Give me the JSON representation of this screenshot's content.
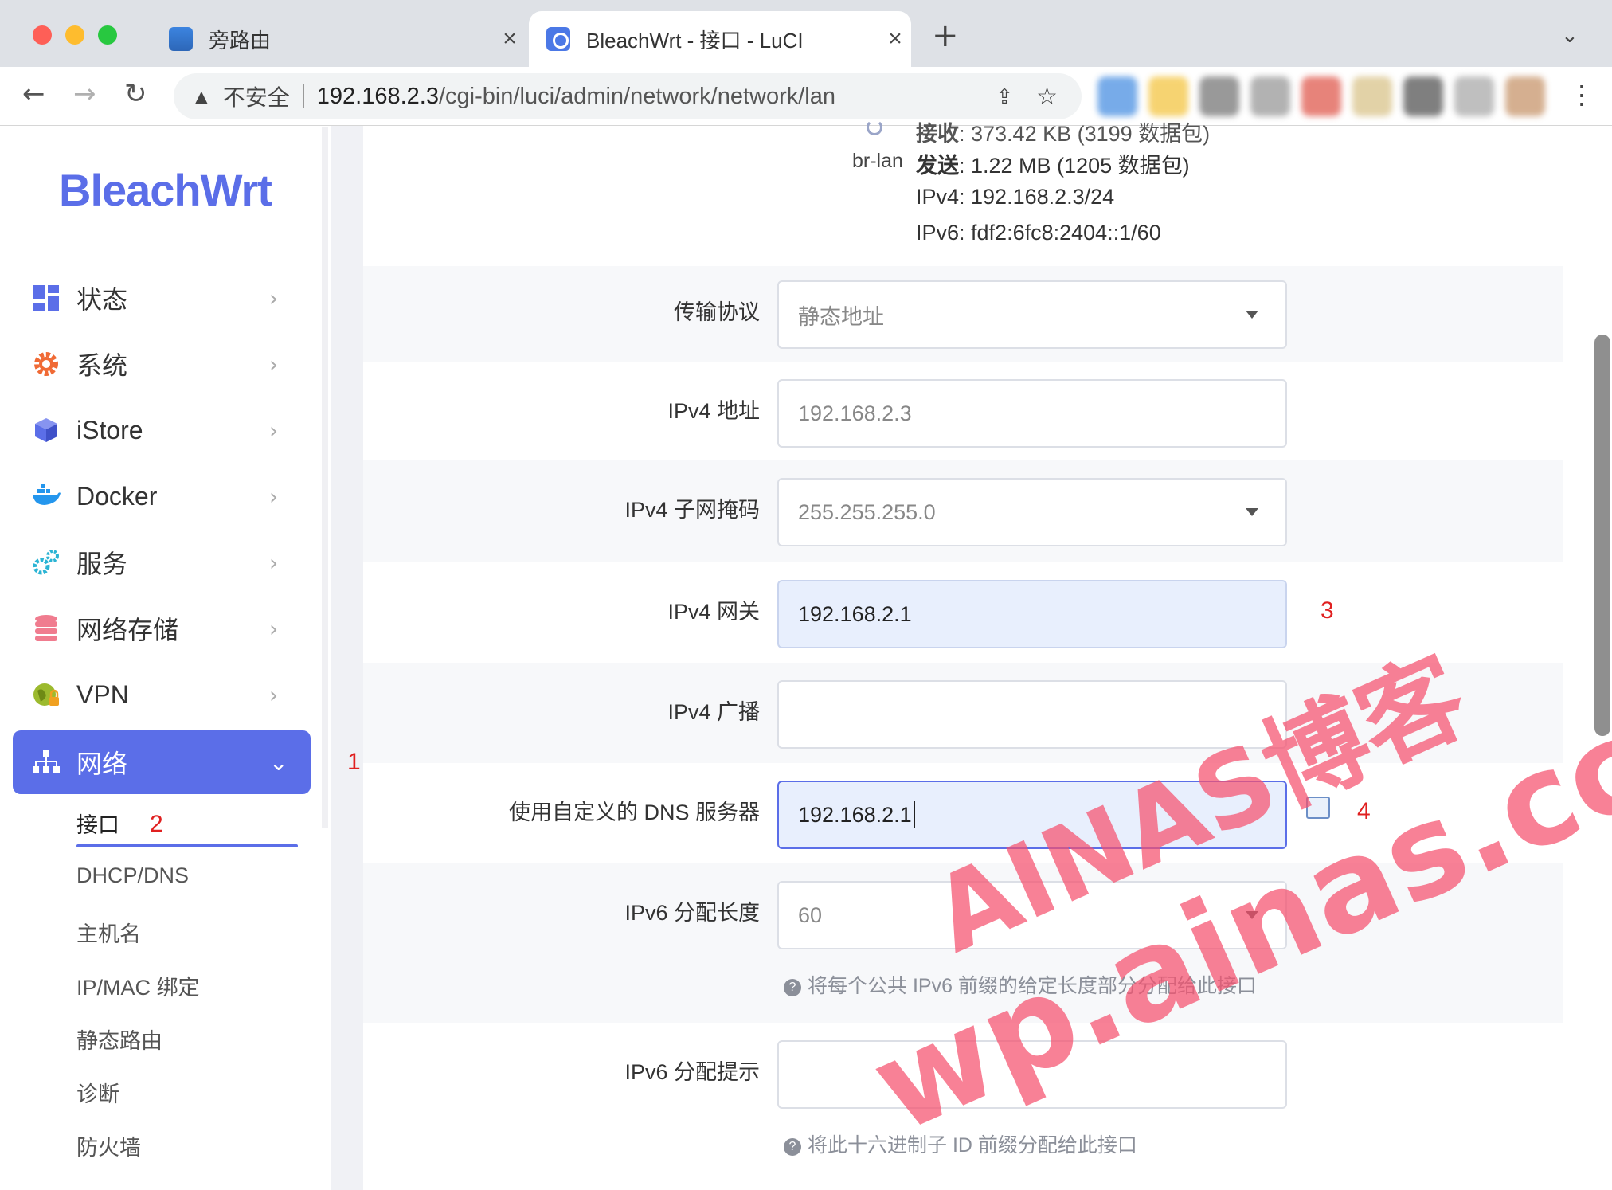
{
  "browser": {
    "tabs": [
      {
        "title": "旁路由",
        "active": false
      },
      {
        "title": "BleachWrt - 接口 - LuCI",
        "active": true
      }
    ],
    "security_label": "不安全",
    "url_host": "192.168.2.3",
    "url_path": "/cgi-bin/luci/admin/network/network/lan",
    "extension_colors": [
      "#4a90e2",
      "#f4c542",
      "#777777",
      "#999999",
      "#e05a4e",
      "#d9c38a",
      "#555555",
      "#aaaaaa",
      "#c7956b"
    ]
  },
  "sidebar": {
    "logo": "BleachWrt",
    "menu": [
      {
        "label": "状态",
        "icon": "dashboard-icon",
        "color": "#5b6ee8"
      },
      {
        "label": "系统",
        "icon": "gear-icon",
        "color": "#f06a35"
      },
      {
        "label": "iStore",
        "icon": "cube-icon",
        "color": "#5b6ee8"
      },
      {
        "label": "Docker",
        "icon": "docker-icon",
        "color": "#2496ed"
      },
      {
        "label": "服务",
        "icon": "cogs-icon",
        "color": "#2bb4d4"
      },
      {
        "label": "网络存储",
        "icon": "database-icon",
        "color": "#f07c8f"
      },
      {
        "label": "VPN",
        "icon": "globe-lock-icon",
        "color": "#9cba2e"
      },
      {
        "label": "网络",
        "icon": "network-icon",
        "color": "#ffffff"
      }
    ],
    "submenu": [
      "接口",
      "DHCP/DNS",
      "主机名",
      "IP/MAC 绑定",
      "静态路由",
      "诊断",
      "防火墙"
    ],
    "accent": "#5b6ee8"
  },
  "annotations": {
    "a1": "1",
    "a2": "2",
    "a3": "3",
    "a4": "4"
  },
  "interface": {
    "name": "br-lan",
    "rx_label": "接收",
    "rx_value": ": 373.42 KB (3199 数据包)",
    "tx_label": "发送",
    "tx_value": ": 1.22 MB (1205 数据包)",
    "ipv4": "IPv4: 192.168.2.3/24",
    "ipv6": "IPv6: fdf2:6fc8:2404::1/60"
  },
  "form": {
    "protocol": {
      "label": "传输协议",
      "value": "静态地址"
    },
    "ipv4_addr": {
      "label": "IPv4 地址",
      "value": "192.168.2.3"
    },
    "ipv4_mask": {
      "label": "IPv4 子网掩码",
      "value": "255.255.255.0"
    },
    "ipv4_gateway": {
      "label": "IPv4 网关",
      "value": "192.168.2.1"
    },
    "ipv4_broadcast": {
      "label": "IPv4 广播",
      "value": ""
    },
    "dns": {
      "label": "使用自定义的 DNS 服务器",
      "value": "192.168.2.1"
    },
    "ipv6_assign_len": {
      "label": "IPv6 分配长度",
      "value": "60",
      "hint": "将每个公共 IPv6 前缀的给定长度部分分配给此接口"
    },
    "ipv6_assign_hint": {
      "label": "IPv6 分配提示",
      "value": "",
      "hint": "将此十六进制子 ID 前缀分配给此接口"
    }
  },
  "watermark": {
    "line1": "AINAS博客",
    "line2": "wp.ainas.cc"
  }
}
